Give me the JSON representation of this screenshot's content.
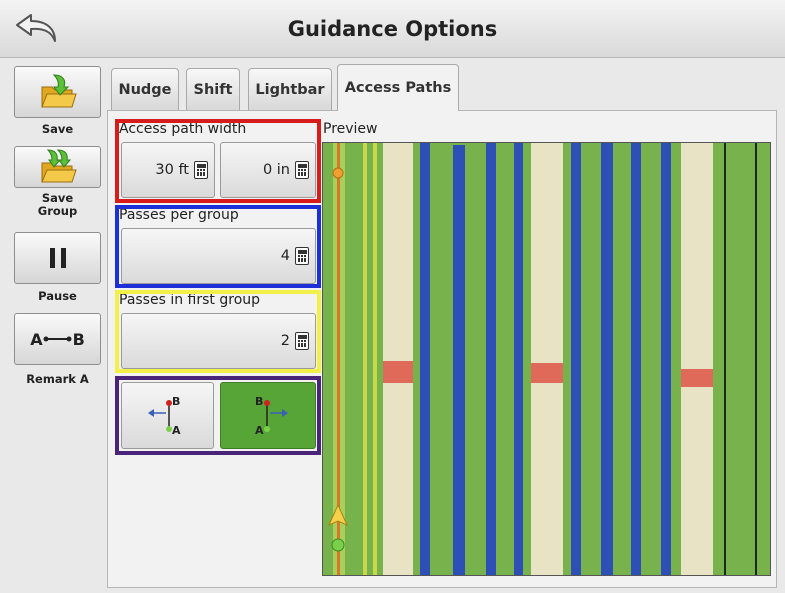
{
  "header": {
    "title": "Guidance Options"
  },
  "sidebar": {
    "save": "Save",
    "save_group": "Save\nGroup",
    "pause": "Pause",
    "ab_glyph_a": "A",
    "ab_glyph_b": "B",
    "remark": "Remark A"
  },
  "tabs": [
    {
      "label": "Nudge"
    },
    {
      "label": "Shift"
    },
    {
      "label": "Lightbar"
    },
    {
      "label": "Access Paths",
      "active": true
    }
  ],
  "access_paths": {
    "width_label": "Access path width",
    "width_ft": "30 ft",
    "width_in": "0 in",
    "passes_per_group_label": "Passes per group",
    "passes_per_group": "4",
    "passes_first_group_label": "Passes in first group",
    "passes_first_group": "2",
    "direction_left_b": "B",
    "direction_left_a": "A",
    "direction_right_b": "B",
    "direction_right_a": "A",
    "preview_label": "Preview"
  },
  "colors": {
    "crop_green": "#77b24d",
    "path_tan": "#e8e3c4",
    "guide_blue": "#2d4fb6",
    "marker_red": "#e06a5a",
    "highlight_red": "#d81b1b",
    "highlight_blue": "#1d2fd6",
    "highlight_yellow": "#f3f04a",
    "highlight_purple": "#4a2478",
    "active_direction": "#56a536"
  }
}
